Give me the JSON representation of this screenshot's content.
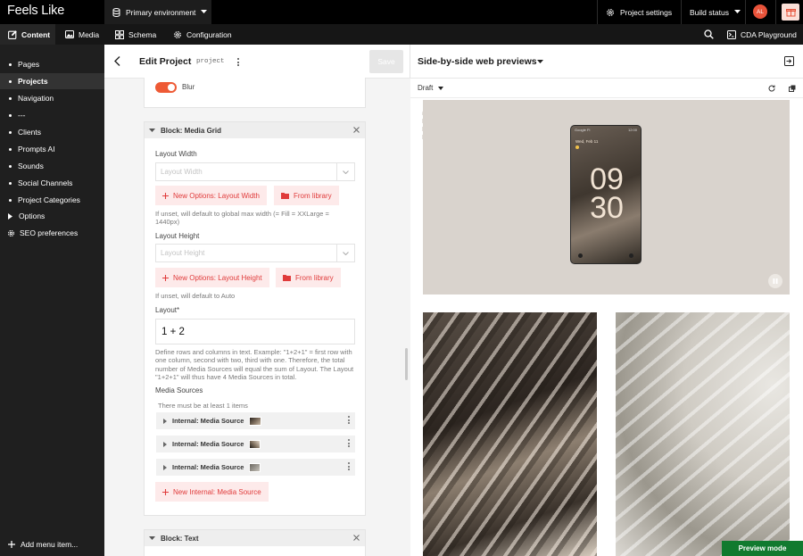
{
  "app": {
    "logo": "Feels Like"
  },
  "topbar": {
    "environment": "Primary environment",
    "project_settings": "Project settings",
    "build_status": "Build status",
    "avatar_initials": "AL"
  },
  "tabs": [
    {
      "label": "Content",
      "icon": "edit-icon"
    },
    {
      "label": "Media",
      "icon": "image-icon"
    },
    {
      "label": "Schema",
      "icon": "schema-icon"
    },
    {
      "label": "Configuration",
      "icon": "gear-icon"
    }
  ],
  "tabbar_right": {
    "cda_label": "CDA Playground"
  },
  "sidebar": {
    "items": [
      {
        "label": "Pages",
        "marker": "dot"
      },
      {
        "label": "Projects",
        "marker": "dot",
        "active": true
      },
      {
        "label": "Navigation",
        "marker": "dot"
      },
      {
        "label": "---",
        "marker": "dot"
      },
      {
        "label": "Clients",
        "marker": "dot"
      },
      {
        "label": "Prompts AI",
        "marker": "dot"
      },
      {
        "label": "Sounds",
        "marker": "dot"
      },
      {
        "label": "Social Channels",
        "marker": "dot"
      },
      {
        "label": "Project Categories",
        "marker": "dot"
      },
      {
        "label": "Options",
        "marker": "chevron"
      },
      {
        "label": "SEO preferences",
        "marker": "gear"
      }
    ],
    "add_label": "Add menu item..."
  },
  "editor": {
    "title": "Edit Project",
    "api_key": "project",
    "save_label": "Save",
    "blur_label": "Blur",
    "block_media_grid": "Block: Media Grid",
    "layout_width_label": "Layout Width",
    "layout_width_placeholder": "Layout Width",
    "new_layout_width": "New Options: Layout Width",
    "from_library": "From library",
    "layout_width_help": "If unset, will default to global max width (= Fill = XXLarge = 1440px)",
    "layout_height_label": "Layout Height",
    "layout_height_placeholder": "Layout Height",
    "new_layout_height": "New Options: Layout Height",
    "layout_height_help": "If unset, will default to Auto",
    "layout_label": "Layout*",
    "layout_value": "1 + 2",
    "layout_help": "Define rows and columns in text. Example: \"1+2+1\" = first row with one column, second with two, third with one. Therefore, the total number of Media Sources will equal the sum of Layout. The Layout \"1+2+1\" will thus have 4 Media Sources in total.",
    "media_sources_label": "Media Sources",
    "media_sources_help": "There must be at least 1 items",
    "media_sources": [
      {
        "label": "Internal: Media Source",
        "thumb_color": "#5a4a3c"
      },
      {
        "label": "Internal: Media Source",
        "thumb_color": "#3e352d"
      },
      {
        "label": "Internal: Media Source",
        "thumb_color": "#9a9389"
      }
    ],
    "new_media_source": "New Internal: Media Source",
    "block_text": "Block: Text"
  },
  "preview": {
    "title": "Side-by-side web previews",
    "status": "Draft",
    "phone_date": "Wed, Feb 11",
    "phone_carrier": "Google Fi",
    "phone_time": "12:00",
    "clock_hour": "09",
    "clock_min": "30",
    "preview_mode": "Preview mode"
  },
  "colors": {
    "accent_red": "#e03b3b",
    "toggle_orange": "#ee5a35",
    "preview_green": "#117a2f"
  }
}
